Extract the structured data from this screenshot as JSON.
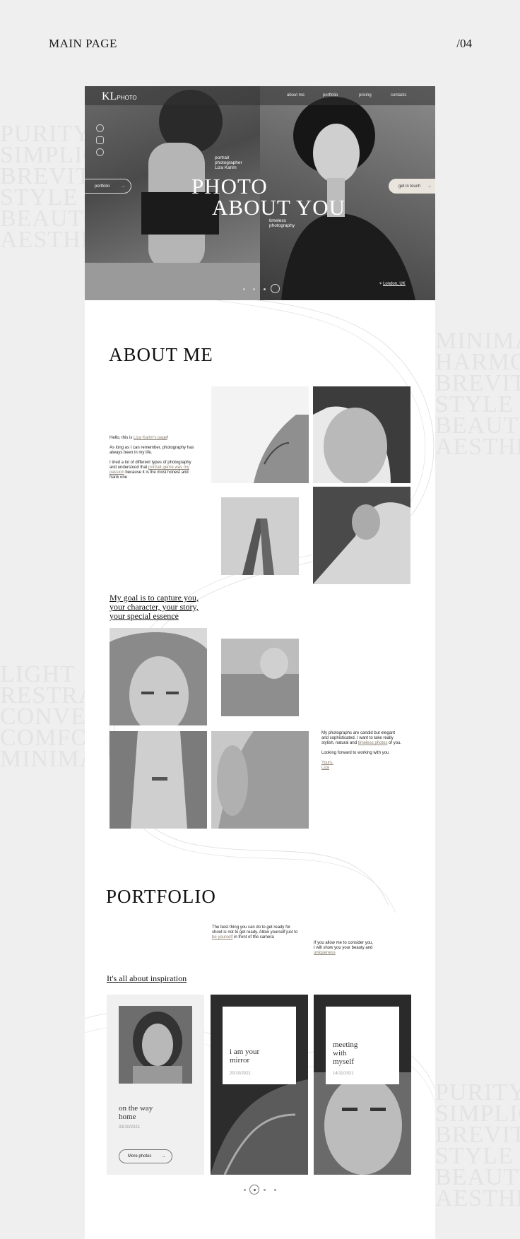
{
  "presentation": {
    "title": "MAIN PAGE",
    "page_number": "/04"
  },
  "bg_words": {
    "left_top": [
      "PURITY",
      "SIMPLIC",
      "BREVIT",
      "STYLE",
      "BEAUTY",
      "AESTHE"
    ],
    "right_mid": [
      "MINIMA",
      "HARMO",
      "BREVITY",
      "STYLE",
      "BEAUTY",
      "AESTHE"
    ],
    "left_mid": [
      "LIGHT",
      "RESTRA",
      "CONVE",
      "COMFO",
      "MINIMA"
    ],
    "right_bottom": [
      "PURITY",
      "SIMPLICITY",
      "BREVITY",
      "STYLE",
      "BEAUTY",
      "AESTHETICS"
    ]
  },
  "hero": {
    "logo_mark": "KL",
    "logo_text": "PHOTO",
    "nav": [
      "about me",
      "portfolio",
      "pricing",
      "contacts"
    ],
    "photographer_lines": [
      "portrait",
      "photographer",
      "Liza Karim"
    ],
    "title_line1": "PHOTO",
    "title_line2": "ABOUT YOU",
    "subtitle_lines": [
      "timeless",
      "photography"
    ],
    "portfolio_button": "portfolio",
    "get_in_touch_button": "get in touch",
    "location": "London, UK"
  },
  "about": {
    "heading": "ABOUT ME",
    "hello_prefix": "Hello, this is ",
    "hello_link": "Liza Karim's page",
    "hello_suffix": "!",
    "para2": "As long as I can remember, photography has always been in my life.",
    "para3_prefix": "I tried a lot of different types of photography and understood that ",
    "para3_link": "portrait genre was my passion",
    "para3_suffix": " because it is the most honest and frank one",
    "goal_lines": [
      "My goal is to capture you,",
      "your character, your story,",
      "your special essence"
    ],
    "candid_prefix": "My photographs are candid but elegant and sophisticated. I want to take really stylish, natural and ",
    "candid_link": "timeless photos",
    "candid_suffix": " of you.",
    "looking_forward": "Looking forward to working with you",
    "sign_yours": "Yours,",
    "sign_name": "Liza"
  },
  "portfolio": {
    "heading": "PORTFOLIO",
    "text1_prefix": "The best thing you can do to get ready for shoot is not to get ready. Allow yourself just to ",
    "text1_link": "be yourself",
    "text1_suffix": " in front of the camera",
    "text2_prefix": "If you allow me to consider you, I will show you your beauty and ",
    "text2_link": "uniqueness",
    "inspiration": "It's all about inspiration",
    "cards": [
      {
        "title_lines": [
          "on the way",
          "home"
        ],
        "date": "03/10/2021",
        "button": "More photos"
      },
      {
        "title_lines": [
          "i am your",
          "mirror"
        ],
        "date": "20/10/2021"
      },
      {
        "title_lines": [
          "meeting",
          "with",
          "myself"
        ],
        "date": "14/11/2021"
      }
    ]
  }
}
